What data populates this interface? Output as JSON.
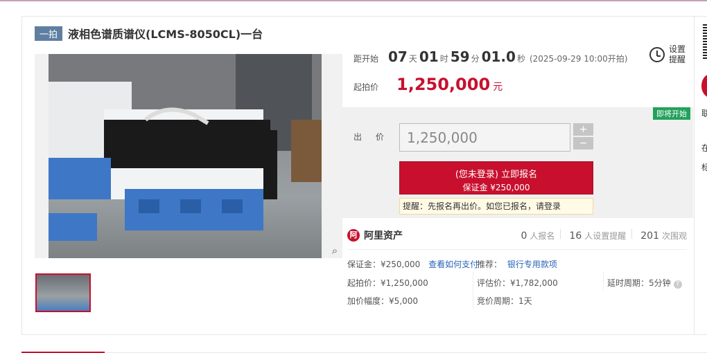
{
  "header": {
    "tag": "一拍",
    "title": "液相色谱质谱仪(LCMS-8050CL)一台"
  },
  "countdown": {
    "label": "距开始",
    "days": "07",
    "days_unit": "天",
    "hours": "01",
    "hours_unit": "时",
    "minutes": "59",
    "minutes_unit": "分",
    "seconds": "01.0",
    "seconds_unit": "秒",
    "start_note": "(2025-09-29 10:00开拍)"
  },
  "reminder": {
    "label": "设置提醒"
  },
  "start_price": {
    "label": "起拍价",
    "value": "1,250,000",
    "unit": "元"
  },
  "bid": {
    "status_badge": "即将开始",
    "label": "出 价",
    "input_value": "1,250,000",
    "plus": "+",
    "minus": "−",
    "signup_line1": "(您未登录) 立即报名",
    "signup_line2": "保证金 ¥250,000",
    "tip_text": "提醒：先报名再出价。如您已报名，请",
    "tip_link": "登录"
  },
  "platform": {
    "logo_char": "阿",
    "name": "阿里资产",
    "stats": [
      {
        "num": "0",
        "label": "人报名"
      },
      {
        "num": "16",
        "label": "人设置提醒"
      },
      {
        "num": "201",
        "label": "次围观"
      }
    ]
  },
  "details": {
    "deposit": "保证金：¥250,000",
    "deposit_link": "查看如何支付",
    "recommend": "推荐：",
    "recommend_link": "银行专用款项",
    "start_price": "起拍价：¥1,250,000",
    "eval_price": "评估价：¥1,782,000",
    "delay": "延时周期：5分钟",
    "increment": "加价幅度：¥5,000",
    "bid_cycle": "竞价周期：1天"
  },
  "sidebar_right": {
    "text1": "联",
    "text2": "在",
    "text3": "标"
  },
  "colors": {
    "accent": "#c8102e",
    "tag": "#5f7fa1",
    "badge": "#22a15b",
    "link": "#2a63b8"
  }
}
